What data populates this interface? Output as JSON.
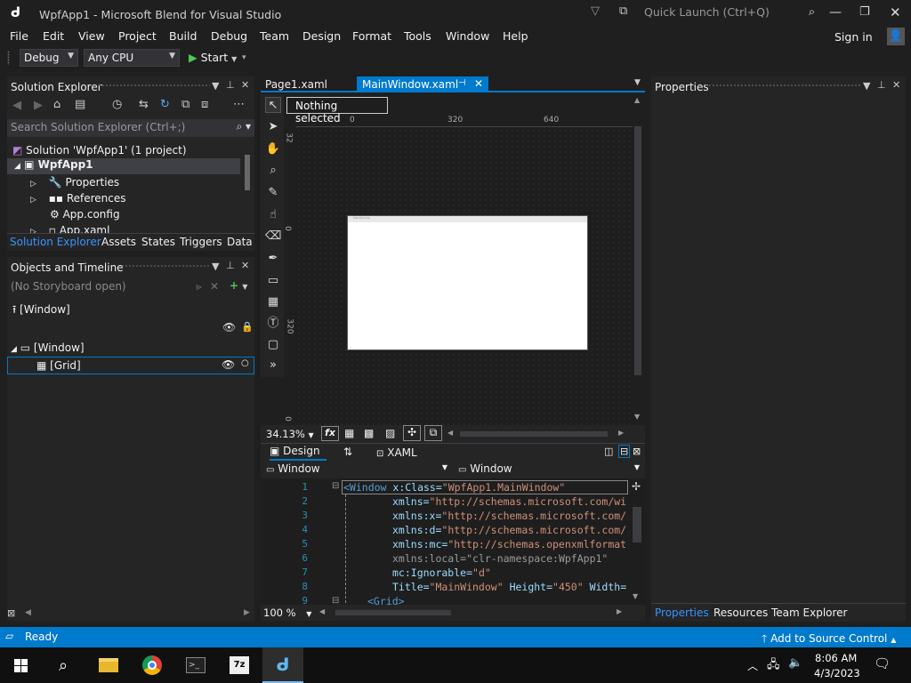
{
  "window": {
    "title": "WpfApp1 - Microsoft Blend for Visual Studio",
    "quick_launch": "Quick Launch (Ctrl+Q)"
  },
  "menu": {
    "items": [
      "File",
      "Edit",
      "View",
      "Project",
      "Build",
      "Debug",
      "Team",
      "Design",
      "Format",
      "Tools",
      "Window",
      "Help"
    ],
    "sign_in": "Sign in"
  },
  "toolbar": {
    "config": "Debug",
    "platform": "Any CPU",
    "start": "Start"
  },
  "solution_explorer": {
    "title": "Solution Explorer",
    "search_placeholder": "Search Solution Explorer (Ctrl+;)",
    "items": [
      "Solution 'WpfApp1' (1 project)",
      "WpfApp1",
      "Properties",
      "References",
      "App.config",
      "App.xaml"
    ],
    "tabs": [
      "Solution Explorer",
      "Assets",
      "States",
      "Triggers",
      "Data"
    ]
  },
  "objects_timeline": {
    "title": "Objects and Timeline",
    "storyboard": "(No Storyboard open)",
    "root": "[Window]",
    "window_node": "[Window]",
    "grid_node": "[Grid]"
  },
  "doc_tabs": {
    "tab1": "Page1.xaml",
    "tab2": "MainWindow.xaml"
  },
  "designer": {
    "selection": "Nothing selected",
    "ruler_top": [
      "0",
      "320",
      "640"
    ],
    "ruler_left": [
      "32",
      "0",
      "320",
      "0"
    ],
    "zoom": "34.13%",
    "fx": "fx",
    "window_caption": "MainWindow"
  },
  "split": {
    "design_tab": "Design",
    "swap": "⇅",
    "xaml_tab": "XAML",
    "scope_left": "Window",
    "scope_right": "Window"
  },
  "code": {
    "line_numbers": [
      "1",
      "2",
      "3",
      "4",
      "5",
      "6",
      "7",
      "8",
      "9"
    ],
    "zoom": "100 %",
    "lines": [
      {
        "tag": "<Window",
        "rest": " x:Class=",
        "str": "\"WpfApp1.MainWindow\""
      },
      {
        "att": "xmlns=",
        "str": "\"http://schemas.microsoft.com/wi"
      },
      {
        "att": "xmlns:x=",
        "str": "\"http://schemas.microsoft.com/"
      },
      {
        "att": "xmlns:d=",
        "str": "\"http://schemas.microsoft.com/"
      },
      {
        "att": "xmlns:mc=",
        "str": "\"http://schemas.openxmlformat"
      },
      {
        "att": "xmlns:local=",
        "str": "\"clr-namespace:WpfApp1\""
      },
      {
        "att": "mc:Ignorable=",
        "str": "\"d\""
      },
      {
        "att": "Title=",
        "str": "\"MainWindow\"",
        "att2": " Height=",
        "str2": "\"450\"",
        "att3": " Width="
      },
      {
        "tag": "<Grid>"
      }
    ]
  },
  "properties": {
    "title": "Properties",
    "tabs": [
      "Properties",
      "Resources",
      "Team Explorer"
    ]
  },
  "status": {
    "ready": "Ready",
    "source_control": "Add to Source Control"
  },
  "taskbar": {
    "time": "8:06 AM",
    "date": "4/3/2023"
  },
  "colors": {
    "accent": "#007acc",
    "chrome": "#1f1f1f",
    "panel": "#252526",
    "active_tab": "#007acc"
  }
}
